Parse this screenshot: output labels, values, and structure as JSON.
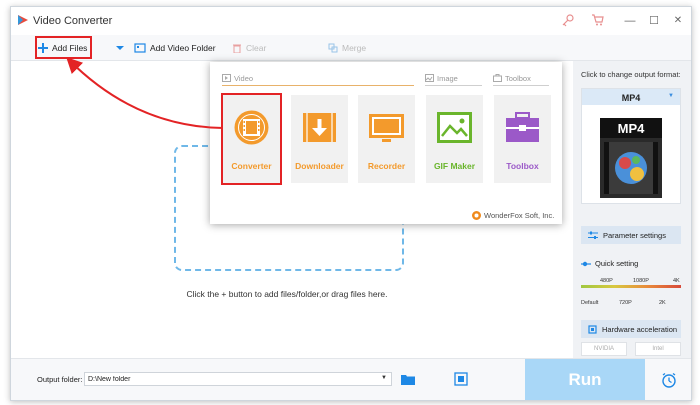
{
  "app": {
    "title": "Video Converter"
  },
  "toolbar": {
    "add_files": "Add Files",
    "add_video_folder": "Add Video Folder",
    "clear": "Clear",
    "merge": "Merge"
  },
  "main": {
    "drop_hint": "Click the + button to add files/folder,or drag files here."
  },
  "popup": {
    "sections": {
      "video": "Video",
      "image": "Image",
      "toolbox": "Toolbox"
    },
    "tiles": [
      {
        "label": "Converter",
        "color": "#f39a2c"
      },
      {
        "label": "Downloader",
        "color": "#f39a2c"
      },
      {
        "label": "Recorder",
        "color": "#f39a2c"
      },
      {
        "label": "GIF Maker",
        "color": "#6ab52c"
      },
      {
        "label": "Toolbox",
        "color": "#9b59c8"
      }
    ],
    "brand": "WonderFox Soft, Inc."
  },
  "right_panel": {
    "title": "Click to change output format:",
    "format": "MP4",
    "thumb_text": "MP4",
    "parameter_settings": "Parameter settings",
    "quick_setting": "Quick setting",
    "quality_top": [
      "480P",
      "1080P",
      "4K"
    ],
    "quality_bottom": [
      "Default",
      "720P",
      "2K"
    ],
    "hardware_acceleration": "Hardware acceleration",
    "nvidia": "NVIDIA",
    "intel": "Intel"
  },
  "bottom": {
    "output_folder_label": "Output folder:",
    "output_folder_value": "D:\\New folder",
    "run": "Run"
  },
  "colors": {
    "accent": "#1e88e5",
    "highlight": "#e32325",
    "run_disabled": "#a9d7f7"
  }
}
